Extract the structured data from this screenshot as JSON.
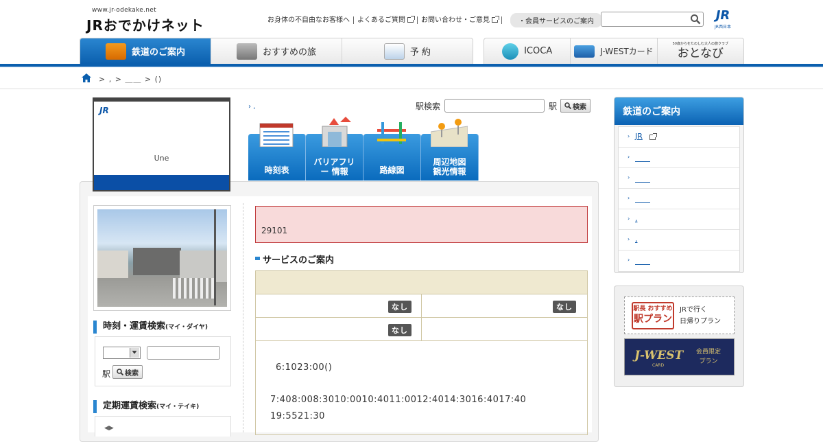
{
  "header": {
    "site_url": "www.jr-odekake.net",
    "site_logo": "JRおでかけネット",
    "links": [
      "お身体の不自由なお客様へ",
      "よくあるご質問",
      "お問い合わせ・ご意見"
    ],
    "member_link": "・会員サービスのご案内",
    "search_placeholder": "",
    "brand_mark": "JR",
    "brand_sub": "JR西日本"
  },
  "global_nav": {
    "left": [
      {
        "label": "鉄道のご案内",
        "icon": "train-icon",
        "active": true
      },
      {
        "label": "おすすめの旅",
        "icon": "camera-icon",
        "active": false
      },
      {
        "label": "予 約",
        "icon": "shinkansen-icon",
        "active": false
      }
    ],
    "right": [
      {
        "label": "ICOCA",
        "icon": "icoca-mascot-icon"
      },
      {
        "label": "J-WESTカード",
        "icon": "card-icon"
      },
      {
        "label": "おとなび",
        "sub": "50歳からをたのしむ大人の旅クラブ"
      }
    ]
  },
  "breadcrumb": {
    "text": "> , > ＿＿ > ()"
  },
  "station": {
    "logo": "JR",
    "name": "Une",
    "top_link": ",",
    "search_label": "駅検索",
    "search_suffix": "駅",
    "search_button": "検索"
  },
  "menu_buttons": [
    {
      "label": "時刻表",
      "icon": "timetable-icon"
    },
    {
      "label": "バリアフリー 情報",
      "icon": "barrier-free-icon"
    },
    {
      "label": "路線図",
      "icon": "route-map-icon"
    },
    {
      "label": "周辺地図 観光情報",
      "icon": "area-map-icon"
    }
  ],
  "left_col": {
    "fare_title": "時刻・運賃検索",
    "fare_title_sub": "(マイ・ダイヤ)",
    "fare_select_value": "",
    "fare_input_value": "",
    "fare_eki": "駅",
    "fare_button": "検索",
    "teiki_title": "定期運賃検索",
    "teiki_title_sub": "(マイ・テイキ)"
  },
  "alert": {
    "text": "29101"
  },
  "service": {
    "title": "サービスのご案内",
    "rows": [
      [
        "なし",
        "なし"
      ],
      [
        "なし",
        ""
      ]
    ],
    "hours": [
      "6:1023:00()",
      "7:408:008:3010:0010:4011:0012:4014:3016:4017:40",
      "19:5521:30"
    ]
  },
  "right_nav": {
    "title": "鉄道のご案内",
    "items": [
      "JR",
      "＿＿",
      "＿＿",
      "＿＿",
      ",",
      ",",
      "＿＿"
    ]
  },
  "banners": {
    "b1_tag": "駅長 おすすめ",
    "b1_big": "駅プラン",
    "b1_line1": "JRで行く",
    "b1_line2": "日帰りプラン",
    "b2_brand": "J-WEST",
    "b2_sub": "CARD",
    "b2_line1": "会員限定",
    "b2_line2": "プラン"
  },
  "colors": {
    "brand_blue": "#0b5fae",
    "alert_bg": "#f8dada",
    "alert_border": "#c0393b"
  }
}
